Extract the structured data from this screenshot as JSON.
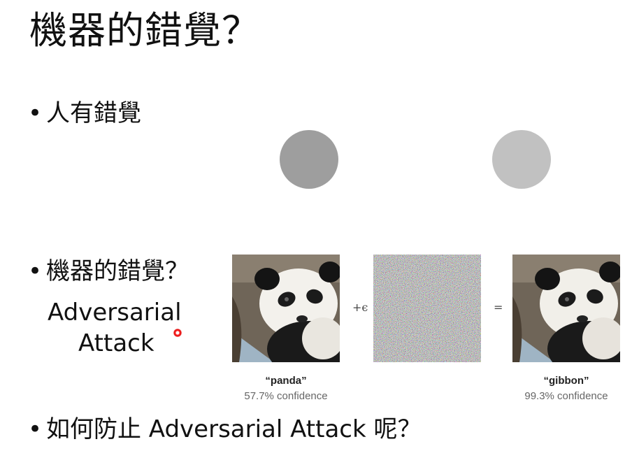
{
  "slide": {
    "title": "機器的錯覺？",
    "bullets": [
      {
        "marker": "•",
        "text": "人有錯覺"
      },
      {
        "marker": "•",
        "text": "機器的錯覺？"
      },
      {
        "marker": "•",
        "text": "如何防止 Adversarial Attack 呢？"
      }
    ],
    "subtitle_line1": "Adversarial",
    "subtitle_line2": "Attack"
  },
  "illusion": {
    "left_circle_color": "#9e9e9e",
    "right_circle_color": "#c1c1c1"
  },
  "figure": {
    "plus_operator": "+ϵ",
    "equals_operator": "=",
    "original": {
      "label": "“panda”",
      "confidence": "57.7% confidence"
    },
    "adversarial": {
      "label": "“gibbon”",
      "confidence": "99.3% confidence"
    }
  }
}
